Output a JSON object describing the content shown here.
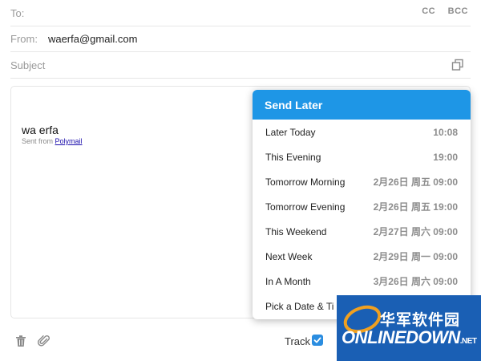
{
  "header": {
    "to_label": "To:",
    "cc_label": "CC",
    "bcc_label": "BCC",
    "from_label": "From:",
    "from_value": "waerfa@gmail.com",
    "subject_placeholder": "Subject"
  },
  "body": {
    "signature_name": "wa erfa",
    "sent_from_prefix": "Sent from",
    "sent_from_link": "Polymail"
  },
  "toolbar": {
    "track_label": "Track",
    "track_checked": true
  },
  "send_later": {
    "title": "Send Later",
    "options": [
      {
        "label": "Later Today",
        "time": "10:08"
      },
      {
        "label": "This Evening",
        "time": "19:00"
      },
      {
        "label": "Tomorrow Morning",
        "time": "2月26日 周五 09:00"
      },
      {
        "label": "Tomorrow Evening",
        "time": "2月26日 周五 19:00"
      },
      {
        "label": "This Weekend",
        "time": "2月27日 周六 09:00"
      },
      {
        "label": "Next Week",
        "time": "2月29日 周一 09:00"
      },
      {
        "label": "In A Month",
        "time": "3月26日 周六 09:00"
      },
      {
        "label": "Pick a Date & Ti",
        "time": ""
      }
    ]
  },
  "watermark": {
    "cn": "华军软件园",
    "en": "ONLINEDOWN",
    "net": ".NET"
  },
  "colors": {
    "accent": "#1e96e6",
    "check": "#2b8de0"
  }
}
